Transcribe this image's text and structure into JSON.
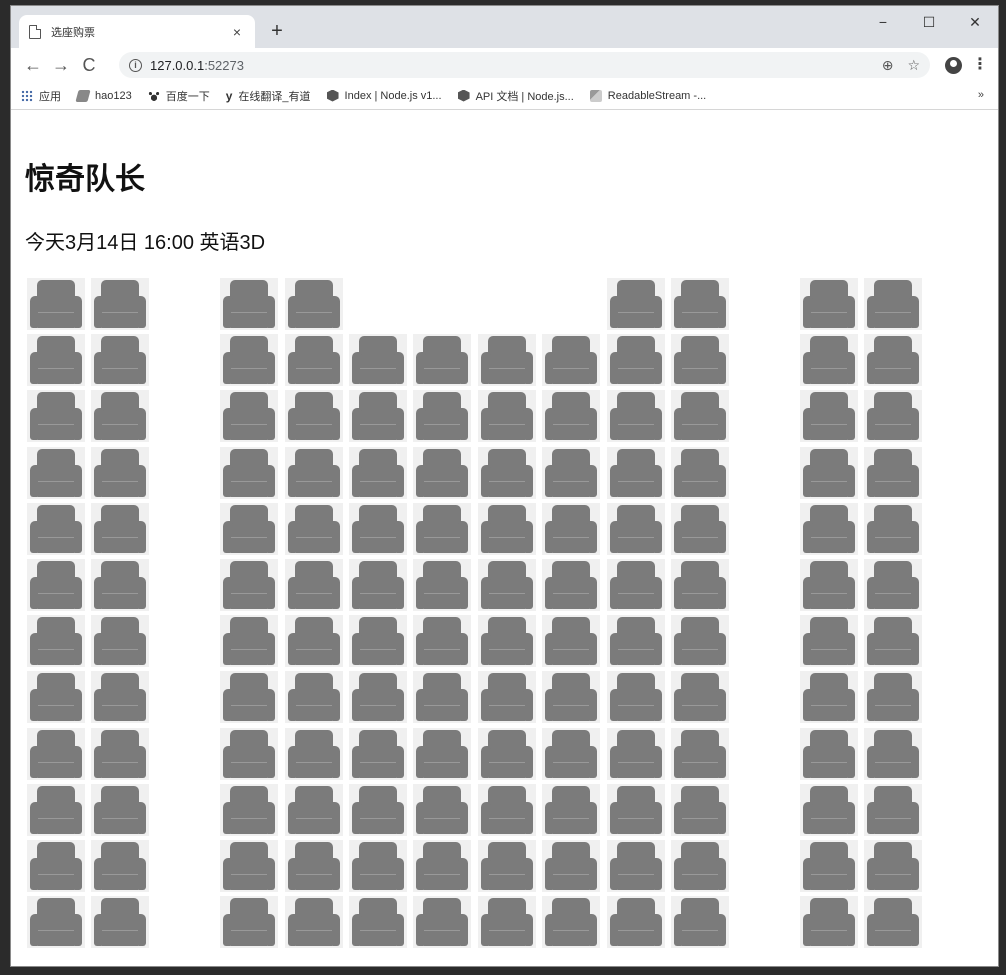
{
  "browser": {
    "tab_title": "选座购票",
    "tab_close": "×",
    "new_tab": "+",
    "window_controls": {
      "minimize": "−",
      "maximize": "☐",
      "close": "✕"
    },
    "nav": {
      "back": "←",
      "forward": "→",
      "reload": "C"
    },
    "url_host": "127.0.0.1",
    "url_port": ":52273",
    "bookmarks": [
      {
        "label": "应用",
        "icon": "apps-icon"
      },
      {
        "label": "hao123",
        "icon": "hao123-icon"
      },
      {
        "label": "百度一下",
        "icon": "baidu-icon"
      },
      {
        "label": "在线翻译_有道",
        "icon": "youdao-icon"
      },
      {
        "label": "Index | Node.js v1...",
        "icon": "nodejs-icon"
      },
      {
        "label": "API 文档 | Node.js...",
        "icon": "nodejs-icon"
      },
      {
        "label": "ReadableStream -...",
        "icon": "stream-icon"
      }
    ],
    "bookmarks_more": "»"
  },
  "page": {
    "movie_title": "惊奇队长",
    "showtime": "今天3月14日 16:00 英语3D"
  },
  "seat_map": {
    "columns": 14,
    "rows": [
      [
        1,
        1,
        0,
        1,
        1,
        0,
        0,
        0,
        0,
        1,
        1,
        0,
        1,
        1
      ],
      [
        1,
        1,
        0,
        1,
        1,
        1,
        1,
        1,
        1,
        1,
        1,
        0,
        1,
        1
      ],
      [
        1,
        1,
        0,
        1,
        1,
        1,
        1,
        1,
        1,
        1,
        1,
        0,
        1,
        1
      ],
      [
        1,
        1,
        0,
        1,
        1,
        1,
        1,
        1,
        1,
        1,
        1,
        0,
        1,
        1
      ],
      [
        1,
        1,
        0,
        1,
        1,
        1,
        1,
        1,
        1,
        1,
        1,
        0,
        1,
        1
      ],
      [
        1,
        1,
        0,
        1,
        1,
        1,
        1,
        1,
        1,
        1,
        1,
        0,
        1,
        1
      ],
      [
        1,
        1,
        0,
        1,
        1,
        1,
        1,
        1,
        1,
        1,
        1,
        0,
        1,
        1
      ],
      [
        1,
        1,
        0,
        1,
        1,
        1,
        1,
        1,
        1,
        1,
        1,
        0,
        1,
        1
      ],
      [
        1,
        1,
        0,
        1,
        1,
        1,
        1,
        1,
        1,
        1,
        1,
        0,
        1,
        1
      ],
      [
        1,
        1,
        0,
        1,
        1,
        1,
        1,
        1,
        1,
        1,
        1,
        0,
        1,
        1
      ],
      [
        1,
        1,
        0,
        1,
        1,
        1,
        1,
        1,
        1,
        1,
        1,
        0,
        1,
        1
      ],
      [
        1,
        1,
        0,
        1,
        1,
        1,
        1,
        1,
        1,
        1,
        1,
        0,
        1,
        1
      ]
    ],
    "seat_icon": "seat-icon",
    "seat_color": "#7b7b7b"
  }
}
